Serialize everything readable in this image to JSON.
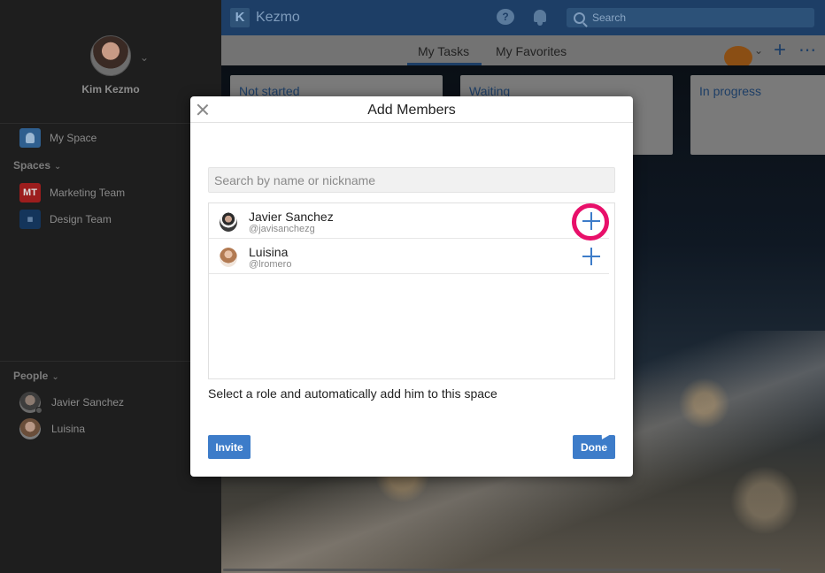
{
  "sidebar": {
    "user_name": "Kim Kezmo",
    "my_space_label": "My Space",
    "spaces_header": "Spaces",
    "spaces": [
      {
        "abbr": "MT",
        "label": "Marketing Team"
      },
      {
        "abbr": "",
        "label": "Design Team"
      }
    ],
    "people_header": "People",
    "people": [
      {
        "label": "Javier Sanchez"
      },
      {
        "label": "Luisina"
      }
    ]
  },
  "topbar": {
    "logo_letter": "K",
    "app_name": "Kezmo",
    "help_glyph": "?",
    "search_placeholder": "Search"
  },
  "tabs": {
    "active": "My Tasks",
    "favorites": "My Favorites"
  },
  "board": {
    "columns": [
      "Not started",
      "Waiting",
      "In progress"
    ]
  },
  "modal": {
    "title": "Add Members",
    "search_placeholder": "Search by name or nickname",
    "members": [
      {
        "name": "Javier Sanchez",
        "handle": "@javisanchezg"
      },
      {
        "name": "Luisina",
        "handle": "@lromero"
      }
    ],
    "role_text": "Select a role and automatically add him to this space",
    "invite_label": "Invite",
    "done_label": "Done"
  },
  "icons": {
    "close": "close-icon",
    "add": "plus-icon",
    "search": "search-icon",
    "help": "chat-help-icon",
    "notifications": "bell-icon"
  },
  "colors": {
    "accent": "#3d7cc9",
    "highlight": "#e8106a",
    "topbar": "#1d3e66"
  }
}
